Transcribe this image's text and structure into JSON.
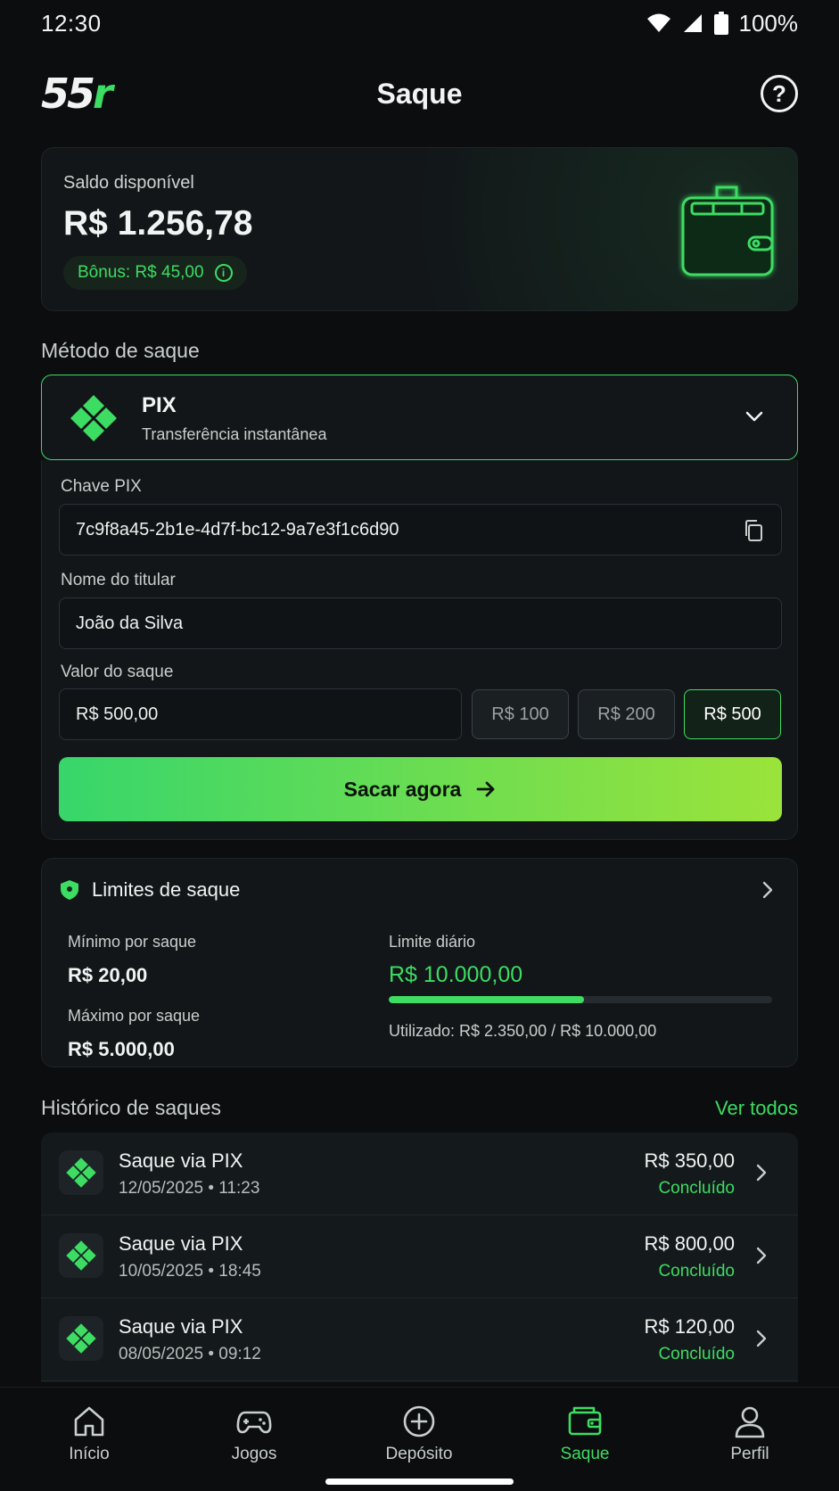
{
  "status_bar": {
    "time": "12:30",
    "battery": "100%"
  },
  "header": {
    "logo_prefix": "55",
    "logo_suffix": "r",
    "title": "Saque",
    "help_icon": "help-icon"
  },
  "balance": {
    "label": "Saldo disponível",
    "value": "R$ 1.256,78",
    "bonus": "Bônus: R$ 45,00",
    "icon": "wallet-icon"
  },
  "method_section": {
    "title": "Método de saque",
    "selected": {
      "name": "PIX",
      "description": "Transferência instantânea",
      "icon": "pix-icon"
    }
  },
  "form": {
    "pix_key": {
      "label": "Chave PIX",
      "value": "7c9f8a45-2b1e-4d7f-bc12-9a7e3f1c6d90"
    },
    "holder": {
      "label": "Nome do titular",
      "value": "João da Silva"
    },
    "amount": {
      "label": "Valor do saque",
      "value": "R$ 500,00"
    },
    "quick_amounts": [
      {
        "label": "R$ 100",
        "active": false
      },
      {
        "label": "R$ 200",
        "active": false
      },
      {
        "label": "R$ 500",
        "active": true
      }
    ],
    "submit_label": "Sacar agora"
  },
  "limits": {
    "title": "Limites de saque",
    "min_label": "Mínimo por saque",
    "min_value": "R$ 20,00",
    "max_label": "Máximo por saque",
    "max_value": "R$ 5.000,00",
    "daily_label": "Limite diário",
    "daily_value": "R$ 10.000,00",
    "used_text": "Utilizado: R$ 2.350,00 / R$ 10.000,00",
    "used_fraction": 0.51
  },
  "history": {
    "title": "Histórico de saques",
    "see_all": "Ver todos",
    "items": [
      {
        "title": "Saque via PIX",
        "date": "12/05/2025 • 11:23",
        "amount": "R$ 350,00",
        "status": "Concluído"
      },
      {
        "title": "Saque via PIX",
        "date": "10/05/2025 • 18:45",
        "amount": "R$ 800,00",
        "status": "Concluído"
      },
      {
        "title": "Saque via PIX",
        "date": "08/05/2025 • 09:12",
        "amount": "R$ 120,00",
        "status": "Concluído"
      }
    ]
  },
  "nav": {
    "items": [
      {
        "label": "Início",
        "icon": "home-icon",
        "active": false
      },
      {
        "label": "Jogos",
        "icon": "gamepad-icon",
        "active": false
      },
      {
        "label": "Depósito",
        "icon": "plus-circle-icon",
        "active": false
      },
      {
        "label": "Saque",
        "icon": "wallet-icon",
        "active": true
      },
      {
        "label": "Perfil",
        "icon": "user-icon",
        "active": false
      }
    ]
  },
  "colors": {
    "accent": "#3ddc63",
    "background": "#0b0d0f",
    "card": "#121619"
  }
}
